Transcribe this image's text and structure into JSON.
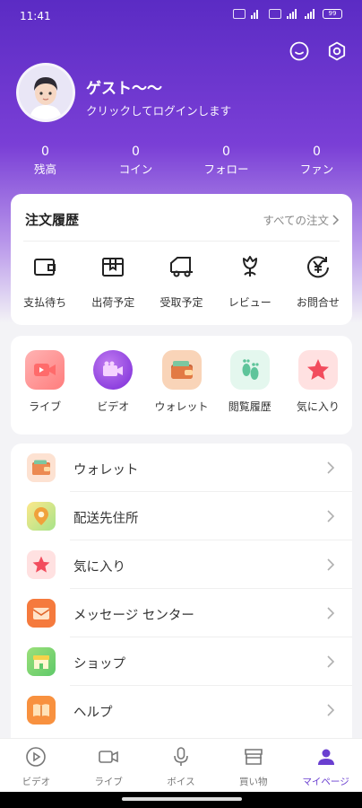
{
  "status": {
    "time": "11:41",
    "battery": "99"
  },
  "profile": {
    "name": "ゲスト～～",
    "subtitle": "クリックしてログインします"
  },
  "stats": [
    {
      "value": "0",
      "label": "残高"
    },
    {
      "value": "0",
      "label": "コイン"
    },
    {
      "value": "0",
      "label": "フォロー"
    },
    {
      "value": "0",
      "label": "ファン"
    }
  ],
  "orders": {
    "title": "注文履歴",
    "all_label": "すべての注文",
    "items": [
      {
        "label": "支払待ち",
        "icon": "wallet-icon"
      },
      {
        "label": "出荷予定",
        "icon": "package-icon"
      },
      {
        "label": "受取予定",
        "icon": "delivery-truck-icon"
      },
      {
        "label": "レビュー",
        "icon": "flower-icon"
      },
      {
        "label": "お問合せ",
        "icon": "yen-refund-icon"
      }
    ]
  },
  "quick": [
    {
      "label": "ライブ",
      "icon": "live-camera-icon",
      "bg": "#ff8f8f"
    },
    {
      "label": "ビデオ",
      "icon": "video-icon",
      "bg": "#8d4be0"
    },
    {
      "label": "ウォレット",
      "icon": "wallet-icon",
      "bg": "#f7c9a6"
    },
    {
      "label": "閲覧履歴",
      "icon": "footprint-icon",
      "bg": "#e6f7ef"
    },
    {
      "label": "気に入り",
      "icon": "star-icon",
      "bg": "#ffe3e3"
    }
  ],
  "menu": [
    {
      "label": "ウォレット",
      "icon": "wallet-icon"
    },
    {
      "label": "配送先住所",
      "icon": "map-pin-icon"
    },
    {
      "label": "気に入り",
      "icon": "star-icon"
    },
    {
      "label": "メッセージ センター",
      "icon": "envelope-icon"
    },
    {
      "label": "ショップ",
      "icon": "shop-icon"
    },
    {
      "label": "ヘルプ",
      "icon": "book-icon"
    }
  ],
  "tabs": [
    {
      "label": "ビデオ",
      "icon": "play-circle-icon"
    },
    {
      "label": "ライブ",
      "icon": "video-camera-icon"
    },
    {
      "label": "ボイス",
      "icon": "microphone-icon"
    },
    {
      "label": "買い物",
      "icon": "store-icon"
    },
    {
      "label": "マイページ",
      "icon": "person-icon"
    }
  ],
  "colors": {
    "accent": "#6a3fd0",
    "hero_top": "#5b2bc4"
  }
}
